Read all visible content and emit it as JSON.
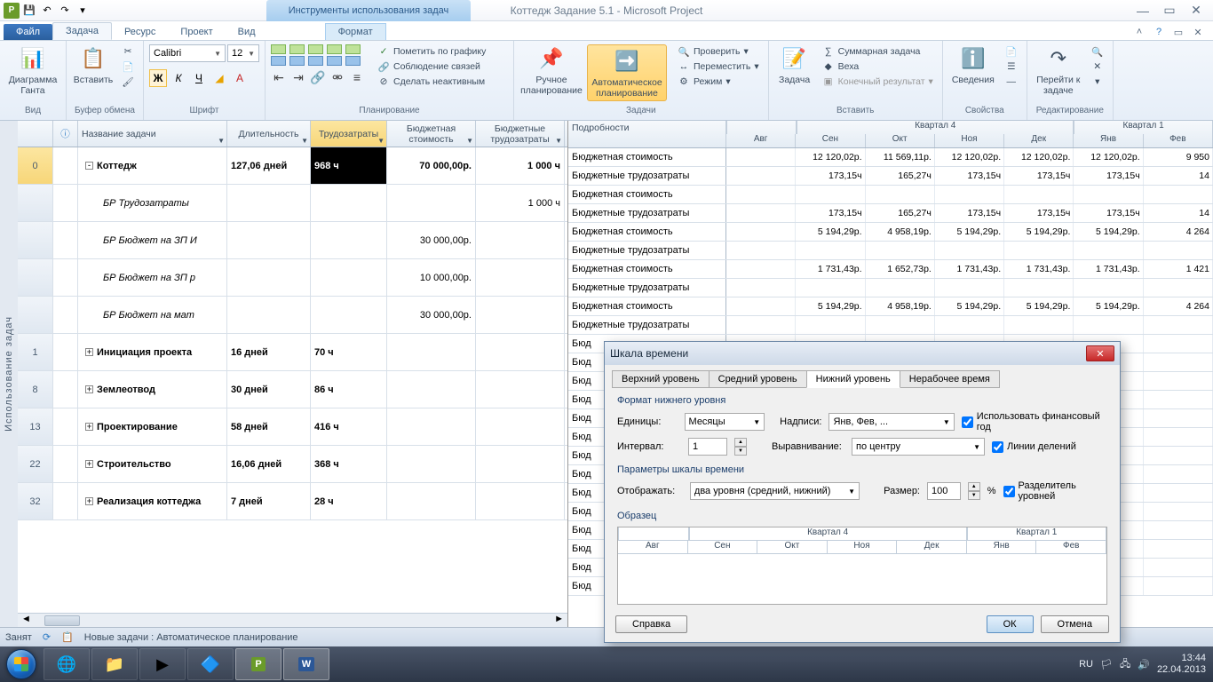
{
  "app": {
    "title": "Коттедж Задание 5.1  -  Microsoft Project",
    "context_tab": "Инструменты использования задач"
  },
  "tabs": {
    "file": "Файл",
    "task": "Задача",
    "resource": "Ресурс",
    "project": "Проект",
    "view": "Вид",
    "format": "Формат"
  },
  "ribbon": {
    "groups": {
      "view": "Вид",
      "clipboard": "Буфер обмена",
      "font": "Шрифт",
      "schedule": "Планирование",
      "tasks": "Задачи",
      "insert": "Вставить",
      "properties": "Свойства",
      "editing": "Редактирование"
    },
    "gantt": "Диаграмма Ганта",
    "paste": "Вставить",
    "font_name": "Calibri",
    "font_size": "12",
    "mark_track": "Пометить по графику",
    "respect_links": "Соблюдение связей",
    "inactivate": "Сделать неактивным",
    "manual": "Ручное планирование",
    "auto": "Автоматическое планирование",
    "inspect": "Проверить",
    "move": "Переместить",
    "mode": "Режим",
    "task_btn": "Задача",
    "summary": "Суммарная задача",
    "milestone": "Веха",
    "deliverable": "Конечный результат",
    "info": "Сведения",
    "scroll_to": "Перейти к задаче"
  },
  "left": {
    "sidebar": "Использование задач",
    "headers": {
      "info": "",
      "name": "Название задачи",
      "duration": "Длительность",
      "work": "Трудозатраты",
      "budget_cost": "Бюджетная стоимость",
      "budget_work": "Бюджетные трудозатраты"
    },
    "rows": [
      {
        "num": "0",
        "name": "Коттедж",
        "dur": "127,06 дней",
        "work": "968 ч",
        "bcost": "70 000,00р.",
        "bwork": "1 000 ч",
        "bold": true,
        "exp": "-",
        "sel": true
      },
      {
        "num": "",
        "name": "БР Трудозатраты",
        "dur": "",
        "work": "",
        "bcost": "",
        "bwork": "1 000 ч",
        "italic": true
      },
      {
        "num": "",
        "name": "БР Бюджет на ЗП И",
        "dur": "",
        "work": "",
        "bcost": "30 000,00р.",
        "bwork": "",
        "italic": true
      },
      {
        "num": "",
        "name": "БР Бюджет на ЗП р",
        "dur": "",
        "work": "",
        "bcost": "10 000,00р.",
        "bwork": "",
        "italic": true
      },
      {
        "num": "",
        "name": "БР Бюджет на мат",
        "dur": "",
        "work": "",
        "bcost": "30 000,00р.",
        "bwork": "",
        "italic": true
      },
      {
        "num": "1",
        "name": "Инициация проекта",
        "dur": "16 дней",
        "work": "70 ч",
        "bcost": "",
        "bwork": "",
        "bold": true,
        "exp": "+"
      },
      {
        "num": "8",
        "name": "Землеотвод",
        "dur": "30 дней",
        "work": "86 ч",
        "bcost": "",
        "bwork": "",
        "bold": true,
        "exp": "+"
      },
      {
        "num": "13",
        "name": "Проектирование",
        "dur": "58 дней",
        "work": "416 ч",
        "bcost": "",
        "bwork": "",
        "bold": true,
        "exp": "+"
      },
      {
        "num": "22",
        "name": "Строительство",
        "dur": "16,06 дней",
        "work": "368 ч",
        "bcost": "",
        "bwork": "",
        "bold": true,
        "exp": "+"
      },
      {
        "num": "32",
        "name": "Реализация коттеджа",
        "dur": "7 дней",
        "work": "28 ч",
        "bcost": "",
        "bwork": "",
        "bold": true,
        "exp": "+"
      }
    ]
  },
  "right": {
    "details": "Подробности",
    "quarters": [
      "Квартал 4",
      "Квартал 1"
    ],
    "months": [
      "Авг",
      "Сен",
      "Окт",
      "Ноя",
      "Дек",
      "Янв",
      "Фев"
    ],
    "row_labels": [
      "Бюджетная стоимость",
      "Бюджетные трудозатраты",
      "Бюджетная стоимость",
      "Бюджетные трудозатраты",
      "Бюджетная стоимость",
      "Бюджетные трудозатраты",
      "Бюджетная стоимость",
      "Бюджетные трудозатраты",
      "Бюджетная стоимость",
      "Бюджетные трудозатраты",
      "Бюд",
      "Бюд",
      "Бюд",
      "Бюд",
      "Бюд",
      "Бюд",
      "Бюд",
      "Бюд",
      "Бюд",
      "Бюд",
      "Бюд",
      "Бюд",
      "Бюд",
      "Бюд"
    ],
    "cells": [
      [
        "",
        "12 120,02р.",
        "11 569,11р.",
        "12 120,02р.",
        "12 120,02р.",
        "12 120,02р.",
        "9 950"
      ],
      [
        "",
        "173,15ч",
        "165,27ч",
        "173,15ч",
        "173,15ч",
        "173,15ч",
        "14"
      ],
      [
        "",
        "",
        "",
        "",
        "",
        "",
        ""
      ],
      [
        "",
        "173,15ч",
        "165,27ч",
        "173,15ч",
        "173,15ч",
        "173,15ч",
        "14"
      ],
      [
        "",
        "5 194,29р.",
        "4 958,19р.",
        "5 194,29р.",
        "5 194,29р.",
        "5 194,29р.",
        "4 264"
      ],
      [
        "",
        "",
        "",
        "",
        "",
        "",
        ""
      ],
      [
        "",
        "1 731,43р.",
        "1 652,73р.",
        "1 731,43р.",
        "1 731,43р.",
        "1 731,43р.",
        "1 421"
      ],
      [
        "",
        "",
        "",
        "",
        "",
        "",
        ""
      ],
      [
        "",
        "5 194,29р.",
        "4 958,19р.",
        "5 194,29р.",
        "5 194,29р.",
        "5 194,29р.",
        "4 264"
      ],
      [
        "",
        "",
        "",
        "",
        "",
        "",
        ""
      ]
    ]
  },
  "dialog": {
    "title": "Шкала времени",
    "tabs": [
      "Верхний уровень",
      "Средний уровень",
      "Нижний уровень",
      "Нерабочее время"
    ],
    "active_tab": 2,
    "sect1": "Формат нижнего уровня",
    "units_l": "Единицы:",
    "units_v": "Месяцы",
    "labels_l": "Надписи:",
    "labels_v": "Янв, Фев, ...",
    "fy": "Использовать финансовый год",
    "interval_l": "Интервал:",
    "interval_v": "1",
    "align_l": "Выравнивание:",
    "align_v": "по центру",
    "ticks": "Линии делений",
    "sect2": "Параметры шкалы времени",
    "show_l": "Отображать:",
    "show_v": "два уровня (средний, нижний)",
    "size_l": "Размер:",
    "size_v": "100",
    "pct": "%",
    "sep": "Разделитель уровней",
    "sect3": "Образец",
    "prev_quarters": [
      "Квартал 4",
      "Квартал 1"
    ],
    "prev_months": [
      "Авг",
      "Сен",
      "Окт",
      "Ноя",
      "Дек",
      "Янв",
      "Фев"
    ],
    "help": "Справка",
    "ok": "ОК",
    "cancel": "Отмена"
  },
  "status": {
    "ready": "Занят",
    "new_tasks": "Новые задачи : Автоматическое планирование"
  },
  "tray": {
    "lang": "RU",
    "time": "13:44",
    "date": "22.04.2013"
  }
}
